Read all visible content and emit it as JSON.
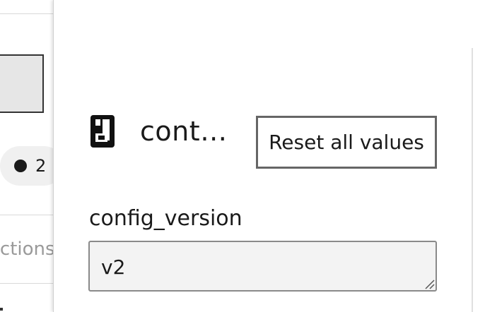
{
  "background": {
    "pill_text": "2",
    "actions_text": "actions"
  },
  "drawer": {
    "icon": "file-icon",
    "title": "cont…",
    "reset_button_label": "Reset all values",
    "field": {
      "label": "config_version",
      "value": "v2"
    }
  },
  "colors": {
    "border_gray": "#666666",
    "input_bg": "#f3f3f3",
    "text": "#1a1a1a",
    "muted_text": "#9a9a9a"
  }
}
